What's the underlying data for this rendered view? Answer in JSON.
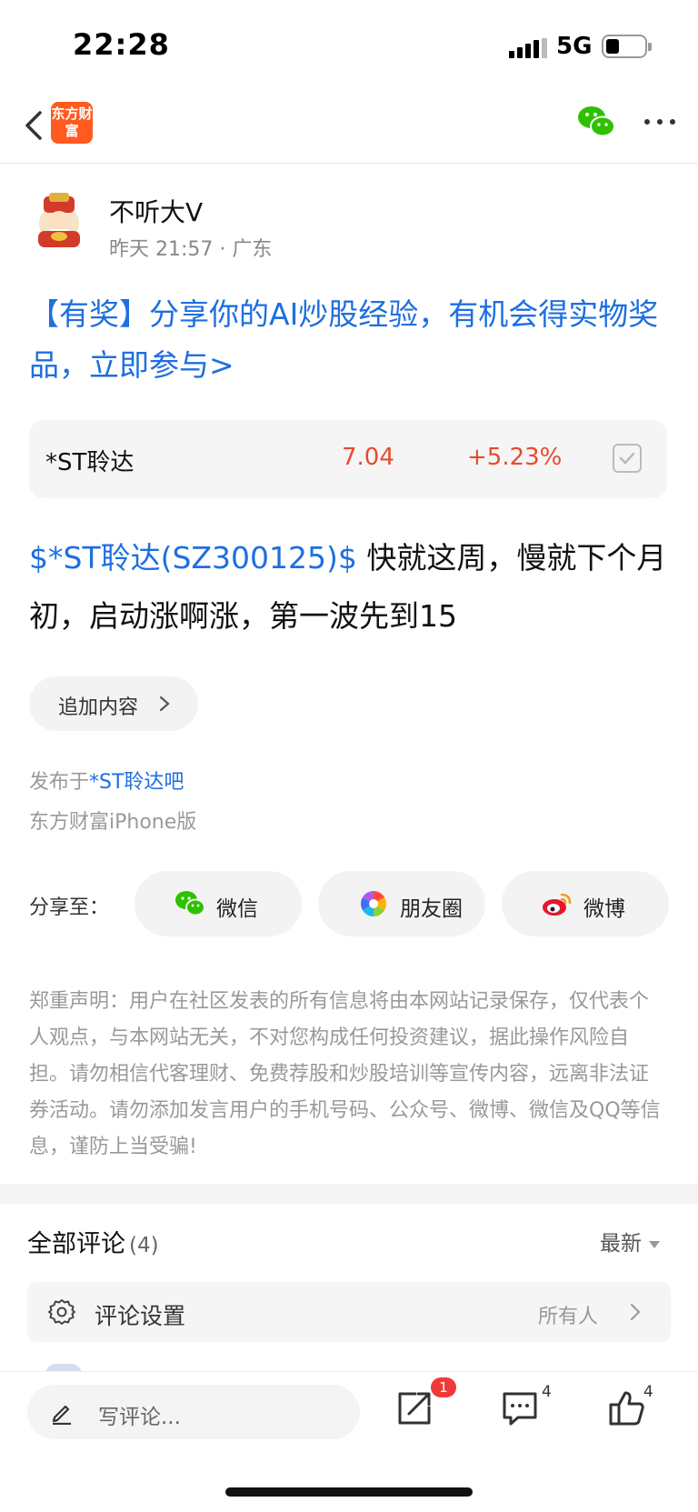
{
  "status_bar": {
    "time": "22:28",
    "network": "5G"
  },
  "nav": {
    "logo_text": "东方财富"
  },
  "author": {
    "name": "不听大V",
    "meta": "昨天 21:57 · 广东"
  },
  "promo": {
    "text": "【有奖】分享你的AI炒股经验，有机会得实物奖品，立即参与>"
  },
  "stock_card": {
    "name": "*ST聆达",
    "price": "7.04",
    "change": "+5.23%"
  },
  "post": {
    "stock_link": "$*ST聆达(SZ300125)$",
    "text": " 快就这周，慢就下个月初，启动涨啊涨，第一波先到15"
  },
  "append": {
    "label": "追加内容"
  },
  "source": {
    "published_prefix": "发布于",
    "forum": "*ST聆达吧",
    "client": "东方财富iPhone版"
  },
  "share": {
    "label": "分享至：",
    "targets": [
      {
        "label": "微信",
        "icon": "wechat-icon"
      },
      {
        "label": "朋友圈",
        "icon": "moments-icon"
      },
      {
        "label": "微博",
        "icon": "weibo-icon"
      }
    ]
  },
  "disclaimer": "郑重声明：用户在社区发表的所有信息将由本网站记录保存，仅代表个人观点，与本网站无关，不对您构成任何投资建议，据此操作风险自担。请勿相信代客理财、免费荐股和炒股培训等宣传内容，远离非法证券活动。请勿添加发言用户的手机号码、公众号、微博、微信及QQ等信息，谨防上当受骗!",
  "comments": {
    "title": "全部评论",
    "count": "(4)",
    "sort": "最新",
    "settings_label": "评论设置",
    "settings_value": "所有人"
  },
  "bottom_bar": {
    "placeholder": "写评论...",
    "share_badge": "1",
    "comment_count": "4",
    "like_count": "4"
  },
  "colors": {
    "link": "#1e6fe0",
    "up": "#e84a2f",
    "brand": "#ff5a1f",
    "wechat": "#2dc100"
  }
}
